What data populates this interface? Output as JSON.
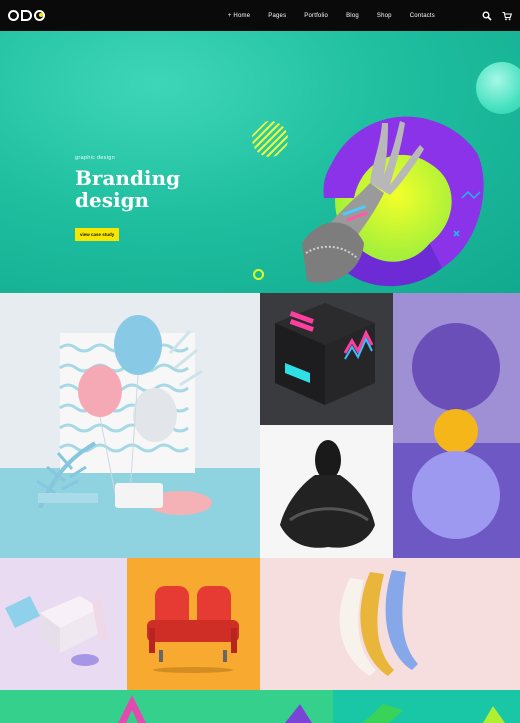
{
  "nav": {
    "menu": [
      "+ Home",
      "Pages",
      "Portfolio",
      "Blog",
      "Shop",
      "Contacts"
    ],
    "icons": [
      "search-icon",
      "cart-icon"
    ]
  },
  "hero": {
    "eyebrow": "graphic design",
    "title": "Branding design",
    "cta": "view case study"
  },
  "colors": {
    "hero_bg": "#1fbfa0",
    "cta": "#f7e600",
    "nav_bg": "#0a0a0a"
  }
}
